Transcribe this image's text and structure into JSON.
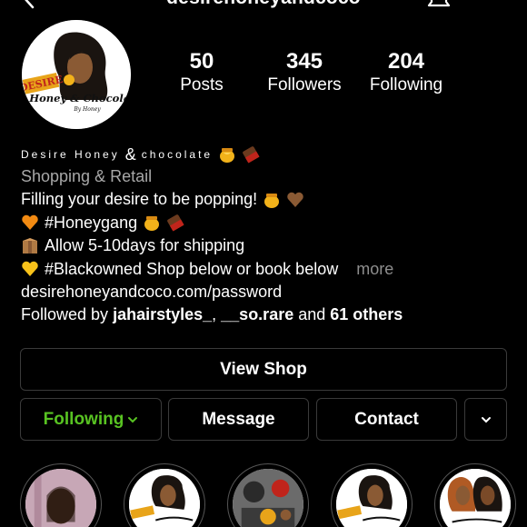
{
  "header": {
    "username": "desirehoneyandcoco"
  },
  "profile": {
    "avatar_text_top": "DESIRE",
    "avatar_text_main": "Honey & Chocolate",
    "avatar_text_by": "By Honey"
  },
  "stats": [
    {
      "value": "50",
      "label": "Posts"
    },
    {
      "value": "345",
      "label": "Followers"
    },
    {
      "value": "204",
      "label": "Following"
    }
  ],
  "bio": {
    "name_part1": "Desire Honey",
    "name_amp": "&",
    "name_part2": "chocolate",
    "category": "Shopping & Retail",
    "line1": "Filling your desire to be popping!",
    "line2": "#Honeygang",
    "line3": "Allow 5-10days for shipping",
    "line4": "#Blackowned Shop below or book below",
    "more": "more",
    "link": "desirehoneyandcoco.com/password",
    "followed_prefix": "Followed by ",
    "followed_user1": "jahairstyles_",
    "followed_sep": ", ",
    "followed_user2": "__so.rare",
    "followed_and": " and ",
    "followed_others": "61 others"
  },
  "buttons": {
    "view_shop": "View Shop",
    "following": "Following",
    "message": "Message",
    "contact": "Contact"
  },
  "colors": {
    "following_green": "#58c322",
    "category_grey": "#a8a8a8"
  },
  "icons": [
    "back-arrow-icon",
    "bell-icon",
    "honey-pot-emoji",
    "chocolate-emoji",
    "orange-heart-emoji",
    "brown-heart-emoji",
    "yellow-heart-emoji",
    "package-emoji",
    "chevron-down-icon"
  ]
}
